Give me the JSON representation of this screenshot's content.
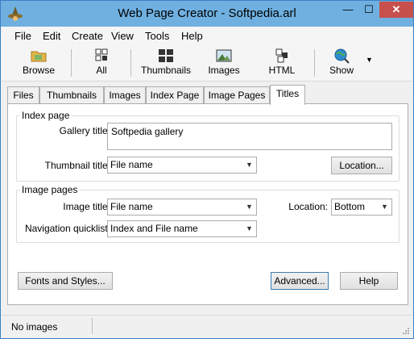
{
  "window": {
    "title": "Web Page Creator - Softpedia.arl",
    "icon": "wizard-hat-icon"
  },
  "menu": [
    "File",
    "Edit",
    "Create",
    "View",
    "Tools",
    "Help"
  ],
  "toolbar": {
    "browse": "Browse",
    "all": "All",
    "thumbnails": "Thumbnails",
    "images": "Images",
    "html": "HTML",
    "show": "Show"
  },
  "tabs": [
    "Files",
    "Thumbnails",
    "Images",
    "Index Page",
    "Image Pages",
    "Titles"
  ],
  "active_tab": "Titles",
  "index_page": {
    "group_title": "Index page",
    "gallery_title_label": "Gallery title:",
    "gallery_title_value": "Softpedia gallery",
    "thumbnail_title_label": "Thumbnail title:",
    "thumbnail_title_value": "File name",
    "location_button": "Location..."
  },
  "image_pages": {
    "group_title": "Image pages",
    "image_title_label": "Image title:",
    "image_title_value": "File name",
    "location_label": "Location:",
    "location_value": "Bottom",
    "nav_label": "Navigation quicklist:",
    "nav_value": "Index and File name"
  },
  "buttons": {
    "fonts_styles": "Fonts and Styles...",
    "advanced": "Advanced...",
    "help": "Help"
  },
  "status": {
    "text": "No images"
  }
}
